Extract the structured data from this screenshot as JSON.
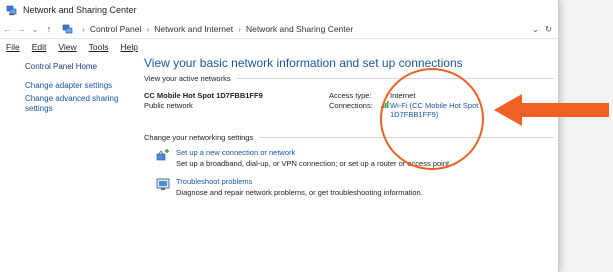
{
  "window": {
    "title": "Network and Sharing Center"
  },
  "address": {
    "crumbs": [
      "Control Panel",
      "Network and Internet",
      "Network and Sharing Center"
    ],
    "nav": {
      "back": "←",
      "forward": "→",
      "recent": "⌄",
      "up": "↑"
    },
    "dropdown": "⌄",
    "refresh": "↻"
  },
  "menu": [
    "File",
    "Edit",
    "View",
    "Tools",
    "Help"
  ],
  "sidebar": {
    "home": "Control Panel Home",
    "links": [
      "Change adapter settings",
      "Change advanced sharing settings"
    ]
  },
  "main": {
    "heading": "View your basic network information and set up connections",
    "active_networks_label": "View your active networks",
    "network": {
      "name": "CC Mobile Hot Spot 1D7FBB1FF9",
      "type": "Public network",
      "access_type_label": "Access type:",
      "access_type_value": "Internet",
      "connections_label": "Connections:",
      "connection_value": "Wi-Fi (CC Mobile Hot Spot 1D7FBB1FF9)"
    },
    "change_settings_label": "Change your networking settings",
    "settings": [
      {
        "title": "Set up a new connection or network",
        "desc": "Set up a broadband, dial-up, or VPN connection; or set up a router or access point."
      },
      {
        "title": "Troubleshoot problems",
        "desc": "Diagnose and repair network problems, or get troubleshooting information."
      }
    ]
  },
  "annotation": {
    "color": "#f06022"
  }
}
